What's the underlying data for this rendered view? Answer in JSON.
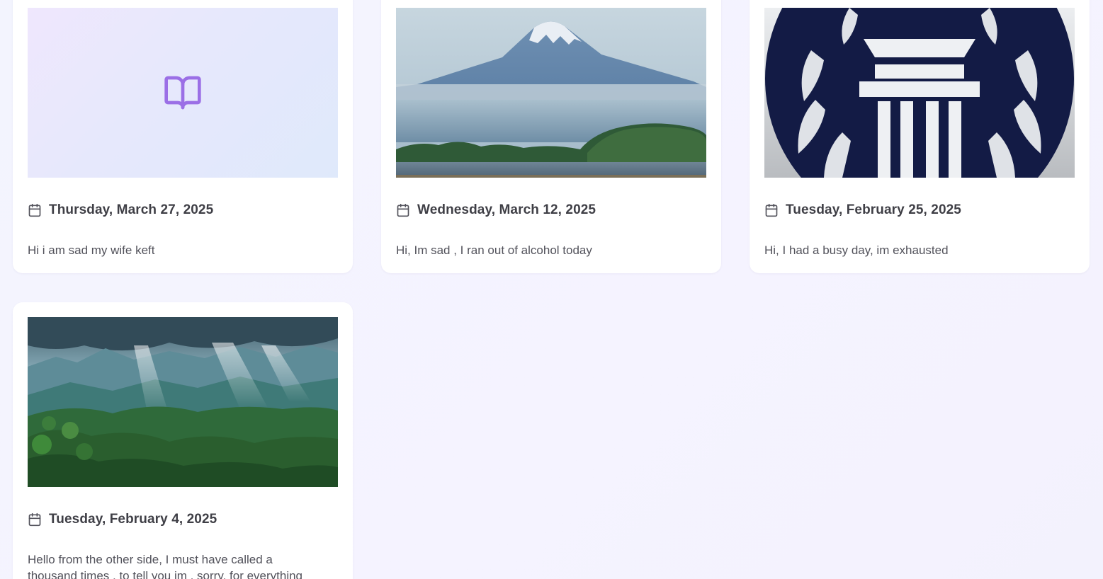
{
  "entries": [
    {
      "date": "Thursday, March 27, 2025",
      "text": "Hi i am sad my wife keft",
      "media": "placeholder-book-icon"
    },
    {
      "date": "Wednesday, March 12, 2025",
      "text": "Hi, Im sad , I ran out of alcohol today",
      "media": "mountain-lake-photo"
    },
    {
      "date": "Tuesday, February 25, 2025",
      "text": "Hi, I had a busy day, im exhausted",
      "media": "temple-emblem-logo"
    },
    {
      "date": "Tuesday, February 4, 2025",
      "text": "Hello from the other side, I must have called a thousand times , to tell you im , sorry, for everything",
      "media": "forest-valley-photo"
    }
  ],
  "colors": {
    "accent": "#9b6fe6",
    "page_background": "#f4f4fe",
    "card_background": "#ffffff",
    "date_text": "#3f3f46",
    "body_text": "#52525b"
  }
}
